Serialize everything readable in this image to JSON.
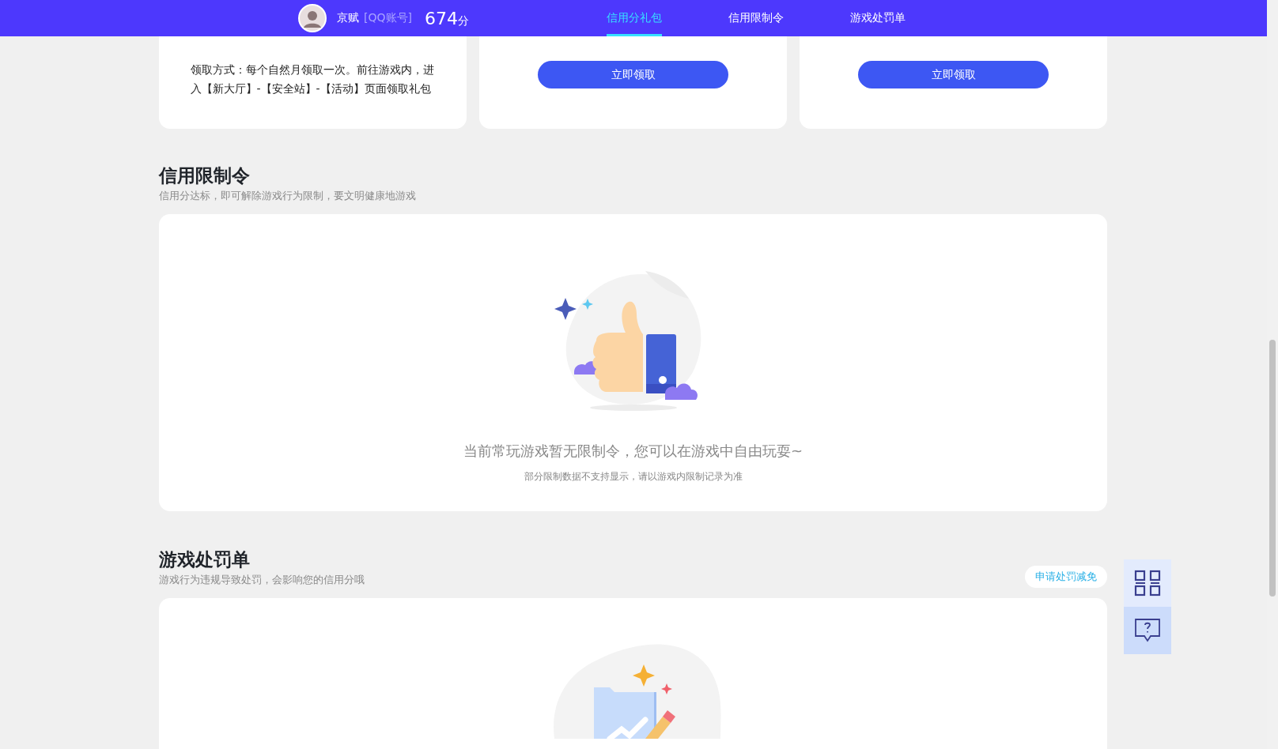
{
  "header": {
    "user": {
      "name": "京赋",
      "account_type": "[QQ账号]",
      "score": "674",
      "score_unit": "分"
    },
    "tabs": [
      {
        "label": "信用分礼包",
        "selected": true
      },
      {
        "label": "信用限制令",
        "selected": false
      },
      {
        "label": "游戏处罚单",
        "selected": false
      }
    ]
  },
  "gift_cards": [
    {
      "kind": "text",
      "text": "领取方式：每个自然月领取一次。前往游戏内，进入【新大厅】-【安全站】-【活动】页面领取礼包"
    },
    {
      "kind": "button",
      "button": "立即领取"
    },
    {
      "kind": "button",
      "button": "立即领取"
    }
  ],
  "sections": [
    {
      "title": "信用限制令",
      "subtitle": "信用分达标，即可解除游戏行为限制，要文明健康地游戏",
      "empty": {
        "kind": "thumbs",
        "message": "当前常玩游戏暂无限制令，您可以在游戏中自由玩耍~",
        "note": "部分限制数据不支持显示，请以游戏内限制记录为准"
      }
    },
    {
      "title": "游戏处罚单",
      "subtitle": "游戏行为违规导致处罚，会影响您的信用分哦",
      "action": "申请处罚减免",
      "empty": {
        "kind": "folder"
      }
    }
  ]
}
